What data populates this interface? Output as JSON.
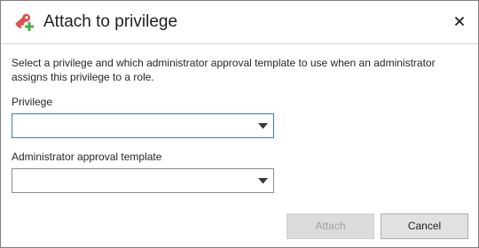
{
  "dialog": {
    "title": "Attach to privilege",
    "title_icon": "key-attach-icon",
    "close_icon": "close-icon"
  },
  "description": "Select a privilege and which administrator approval template to use when an administrator assigns this privilege to a role.",
  "fields": {
    "privilege": {
      "label": "Privilege",
      "value": ""
    },
    "approval_template": {
      "label": "Administrator approval template",
      "value": ""
    }
  },
  "buttons": {
    "attach": "Attach",
    "cancel": "Cancel"
  },
  "colors": {
    "focus_border": "#3c7fb1",
    "icon_red": "#d9534f",
    "icon_green": "#4cae4c"
  }
}
